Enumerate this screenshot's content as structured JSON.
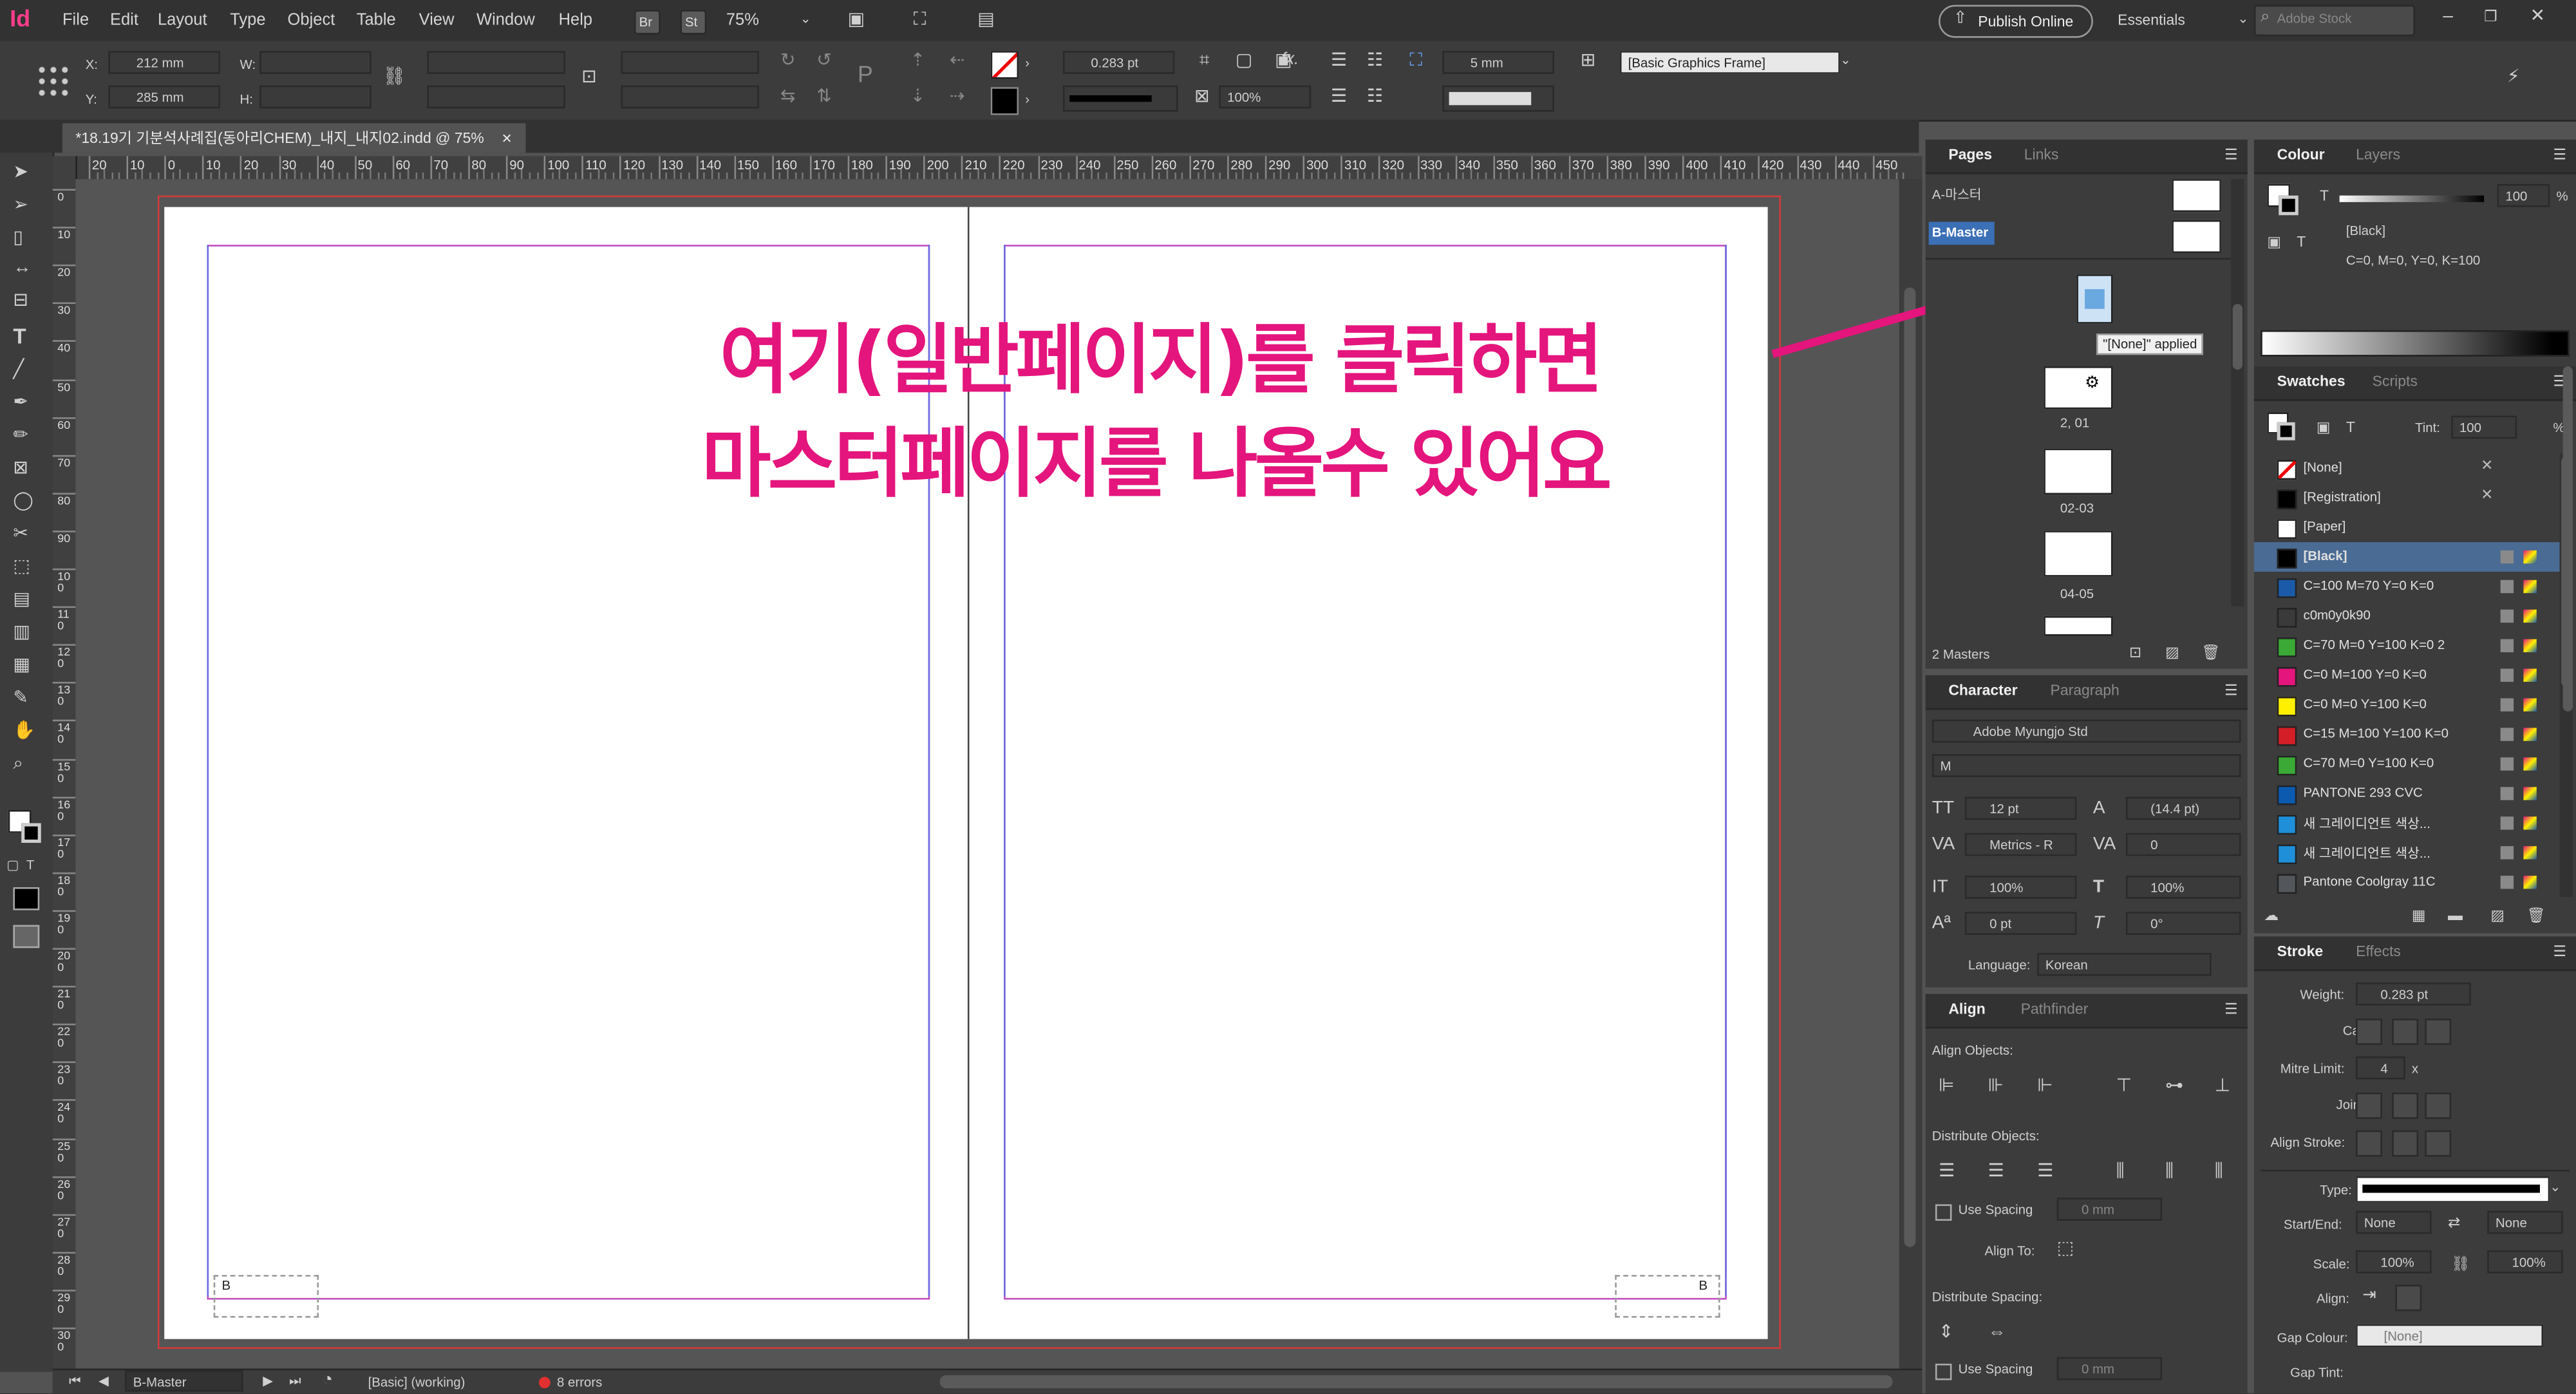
{
  "app": {
    "logo": "Id",
    "zoom": "75%"
  },
  "menu": [
    "File",
    "Edit",
    "Layout",
    "Type",
    "Object",
    "Table",
    "View",
    "Window",
    "Help"
  ],
  "app_bar": {
    "br": "Br",
    "st": "St",
    "publish": "Publish Online",
    "workspace": "Essentials",
    "search_placeholder": "Adobe Stock"
  },
  "control": {
    "x_label": "X:",
    "x": "212 mm",
    "y_label": "Y:",
    "y": "285 mm",
    "w_label": "W:",
    "h_label": "H:",
    "stroke_weight": "0.283 pt",
    "scale": "100%",
    "offset": "5 mm",
    "frame_style": "[Basic Graphics Frame]"
  },
  "document": {
    "tab": "*18.19기 기분석사례집(동아리CHEM)_내지_내지02.indd @ 75%",
    "close": "✕"
  },
  "ruler_h": [
    "20",
    "10",
    "0",
    "10",
    "20",
    "30",
    "40",
    "50",
    "60",
    "70",
    "80",
    "90",
    "100",
    "110",
    "120",
    "130",
    "140",
    "150",
    "160",
    "170",
    "180",
    "190",
    "200",
    "210",
    "220",
    "230",
    "240",
    "250",
    "260",
    "270",
    "280",
    "290",
    "300",
    "310",
    "320",
    "330",
    "340",
    "350",
    "360",
    "370",
    "380",
    "390",
    "400",
    "410",
    "420",
    "430",
    "440",
    "450"
  ],
  "ruler_v": [
    "0",
    "1 0",
    "2 0",
    "3 0",
    "4 0",
    "5 0",
    "6 0",
    "7 0",
    "8 0",
    "9 0",
    "1 0 0",
    "1 1 0",
    "1 2 0",
    "1 3 0",
    "1 4 0",
    "1 5 0",
    "1 6 0",
    "1 7 0",
    "1 8 0",
    "1 9 0",
    "2 0 0",
    "2 1 0",
    "2 2 0",
    "2 3 0",
    "2 4 0",
    "2 5 0",
    "2 6 0",
    "2 7 0",
    "2 8 0",
    "2 9 0",
    "3 0 0"
  ],
  "spread": {
    "left_marker": "B",
    "right_marker": "B"
  },
  "annotation": {
    "line1": "여기(일반페이지)를 클릭하면",
    "line2": "마스터페이지를 나올수 있어요"
  },
  "status": {
    "page": "B-Master",
    "style": "[Basic] (working)",
    "errors": "8 errors"
  },
  "pages_panel": {
    "tabs": [
      "Pages",
      "Links"
    ],
    "masters": [
      "A-마스터",
      "B-Master"
    ],
    "tooltip": "\"[None]\" applied",
    "page_labels": [
      "2, 01",
      "02-03",
      "04-05"
    ],
    "footer": "2 Masters"
  },
  "colour_panel": {
    "tabs": [
      "Colour",
      "Layers"
    ],
    "tint": "100",
    "pct": "%",
    "swatch_name": "[Black]",
    "swatch_values": "C=0, M=0, Y=0, K=100"
  },
  "swatches_panel": {
    "tabs": [
      "Swatches",
      "Scripts"
    ],
    "tint_label": "Tint:",
    "tint": "100",
    "pct": "%",
    "items": [
      {
        "name": "[None]",
        "color": "#ffffff"
      },
      {
        "name": "[Registration]",
        "color": "#000000"
      },
      {
        "name": "[Paper]",
        "color": "#ffffff"
      },
      {
        "name": "[Black]",
        "color": "#000000"
      },
      {
        "name": "C=100 M=70 Y=0 K=0",
        "color": "#1b5aa8"
      },
      {
        "name": "c0m0y0k90",
        "color": "#3a3a3a"
      },
      {
        "name": "C=70 M=0 Y=100 K=0 2",
        "color": "#3aa935"
      },
      {
        "name": "C=0 M=100 Y=0 K=0",
        "color": "#e4157c"
      },
      {
        "name": "C=0 M=0 Y=100 K=0",
        "color": "#fff000"
      },
      {
        "name": "C=15 M=100 Y=100 K=0",
        "color": "#d41e27"
      },
      {
        "name": "C=70 M=0 Y=100 K=0",
        "color": "#3aa935"
      },
      {
        "name": "PANTONE 293 CVC",
        "color": "#0b5ab0"
      },
      {
        "name": "새 그레이디언트 색상...",
        "color": "#1e8fd8"
      },
      {
        "name": "새 그레이디언트 색상...",
        "color": "#1e8fd8"
      },
      {
        "name": "Pantone Coolgray 11C",
        "color": "#53565a"
      }
    ]
  },
  "character_panel": {
    "tabs": [
      "Character",
      "Paragraph"
    ],
    "font": "Adobe Myungjo Std",
    "style": "M",
    "size": "12 pt",
    "leading": "(14.4 pt)",
    "kerning": "Metrics - R",
    "tracking": "0",
    "vscale": "100%",
    "hscale": "100%",
    "baseline": "0 pt",
    "skew": "0°",
    "language_label": "Language:",
    "language": "Korean"
  },
  "align_panel": {
    "tabs": [
      "Align",
      "Pathfinder"
    ],
    "align_objects": "Align Objects:",
    "distribute_objects": "Distribute Objects:",
    "use_spacing": "Use Spacing",
    "spacing": "0 mm",
    "align_to": "Align To:",
    "distribute_spacing": "Distribute Spacing:",
    "use_spacing2": "Use Spacing",
    "spacing2": "0 mm"
  },
  "stroke_panel": {
    "tabs": [
      "Stroke",
      "Effects"
    ],
    "weight_label": "Weight:",
    "weight": "0.283 pt",
    "cap_label": "Cap:",
    "mitre_label": "Mitre Limit:",
    "mitre": "4",
    "mitre_x": "x",
    "join_label": "Join:",
    "align_label": "Align Stroke:",
    "type_label": "Type:",
    "startend_label": "Start/End:",
    "start": "None",
    "end": "None",
    "scale_label": "Scale:",
    "scale1": "100%",
    "scale2": "100%",
    "align2_label": "Align:",
    "gap_colour_label": "Gap Colour:",
    "gap_colour": "[None]",
    "gap_tint_label": "Gap Tint:"
  }
}
